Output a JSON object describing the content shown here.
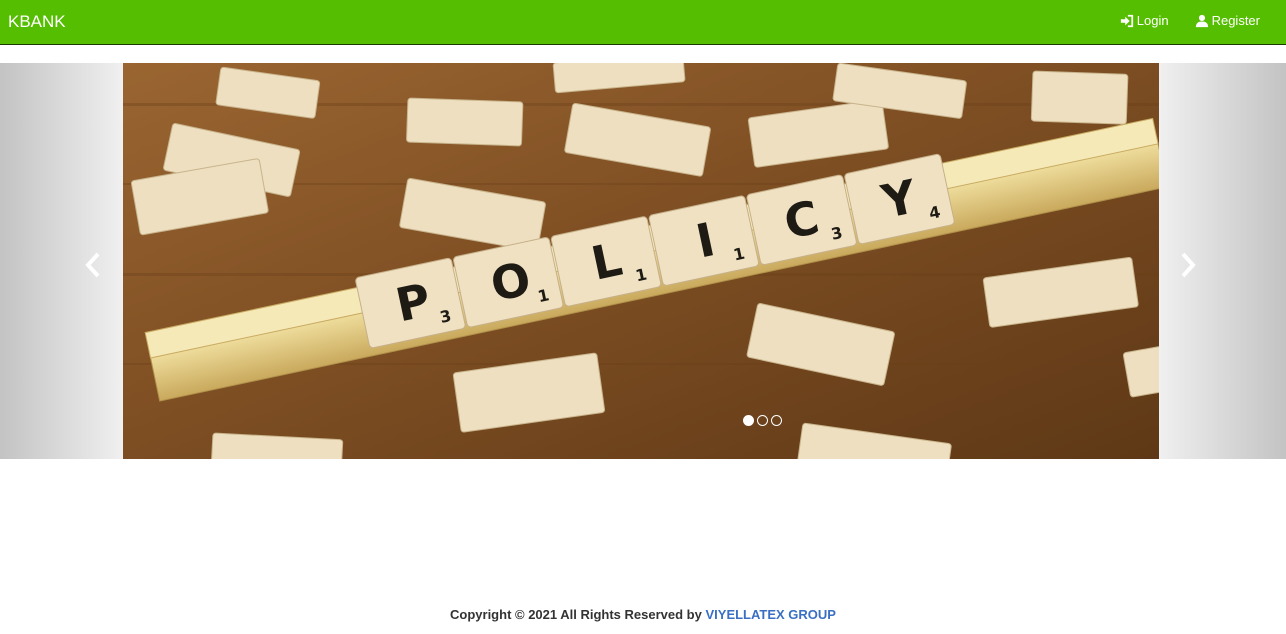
{
  "navbar": {
    "brand": "KBANK",
    "links": [
      {
        "label": "Login",
        "icon": "login-icon"
      },
      {
        "label": "Register",
        "icon": "user-icon"
      }
    ],
    "bg_color": "#55be00"
  },
  "carousel": {
    "slide_alt": "POLICY",
    "tiles_word": [
      "P",
      "O",
      "L",
      "I",
      "C",
      "Y"
    ],
    "tiles_sub": [
      "3",
      "1",
      "1",
      "1",
      "3",
      "4"
    ],
    "indicators": 3,
    "active_index": 0
  },
  "footer": {
    "text": "Copyright © 2021 All Rights Reserved by",
    "link_label": "VIYELLATEX GROUP",
    "link_color": "#3a6fc4"
  }
}
